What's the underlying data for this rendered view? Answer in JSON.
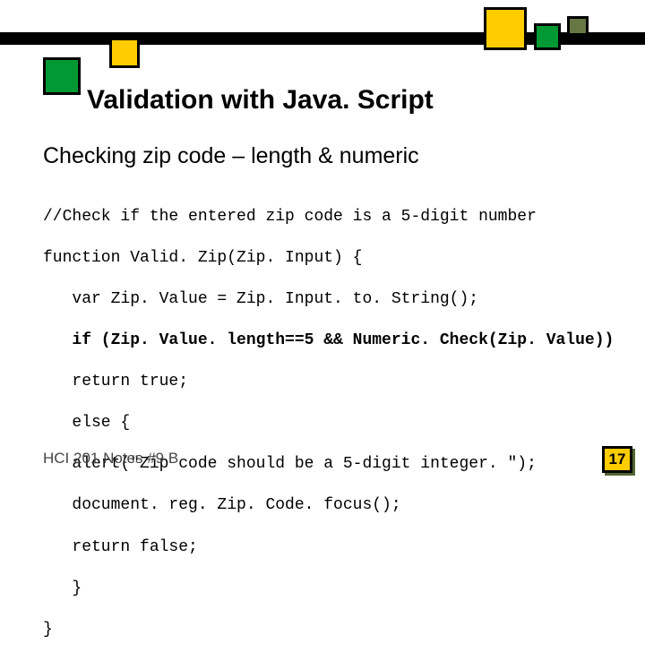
{
  "title": "Validation with Java. Script",
  "subtitle": "Checking zip code – length & numeric",
  "code": {
    "l1": "//Check if the entered zip code is a 5-digit number",
    "l2": "function Valid. Zip(Zip. Input) {",
    "l3": "   var Zip. Value = Zip. Input. to. String();",
    "l4": "   if (Zip. Value. length==5 && Numeric. Check(Zip. Value))",
    "l5": "   return true;",
    "l6": "   else {",
    "l7": "   alert(\"Zip code should be a 5-digit integer. \");",
    "l8": "   document. reg. Zip. Code. focus();",
    "l9": "   return false;",
    "l10": "   }",
    "l11": "}"
  },
  "footer": "HCI 201 Notes #9 B",
  "page_number": "17",
  "colors": {
    "yellow": "#ffcc00",
    "green": "#009933",
    "dark_green": "#667744",
    "black": "#000000"
  }
}
